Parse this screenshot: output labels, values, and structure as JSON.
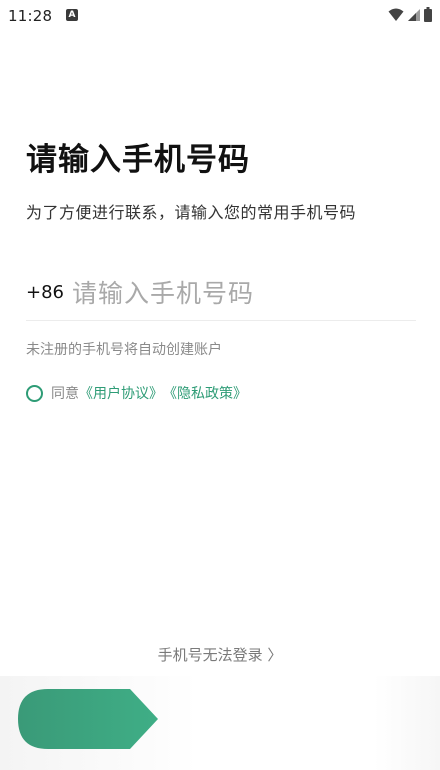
{
  "status_bar": {
    "time": "11:28",
    "notification_icon_letter": "A",
    "icons": [
      "wifi-icon",
      "signal-icon",
      "battery-icon"
    ]
  },
  "title": "请输入手机号码",
  "subtitle": "为了方便进行联系，请输入您的常用手机号码",
  "phone": {
    "country_code": "+86",
    "value": "",
    "placeholder": "请输入手机号码"
  },
  "hint": "未注册的手机号将自动创建账户",
  "agreement": {
    "checked": false,
    "prefix": "同意",
    "user_agreement": "《用户协议》",
    "privacy_policy": "《隐私政策》"
  },
  "cannot_login": "手机号无法登录 〉",
  "colors": {
    "accent": "#2e9c76",
    "button_start": "#3aa37e",
    "button_end": "#35a07a"
  },
  "next_button_icon": "arrow-next-button"
}
